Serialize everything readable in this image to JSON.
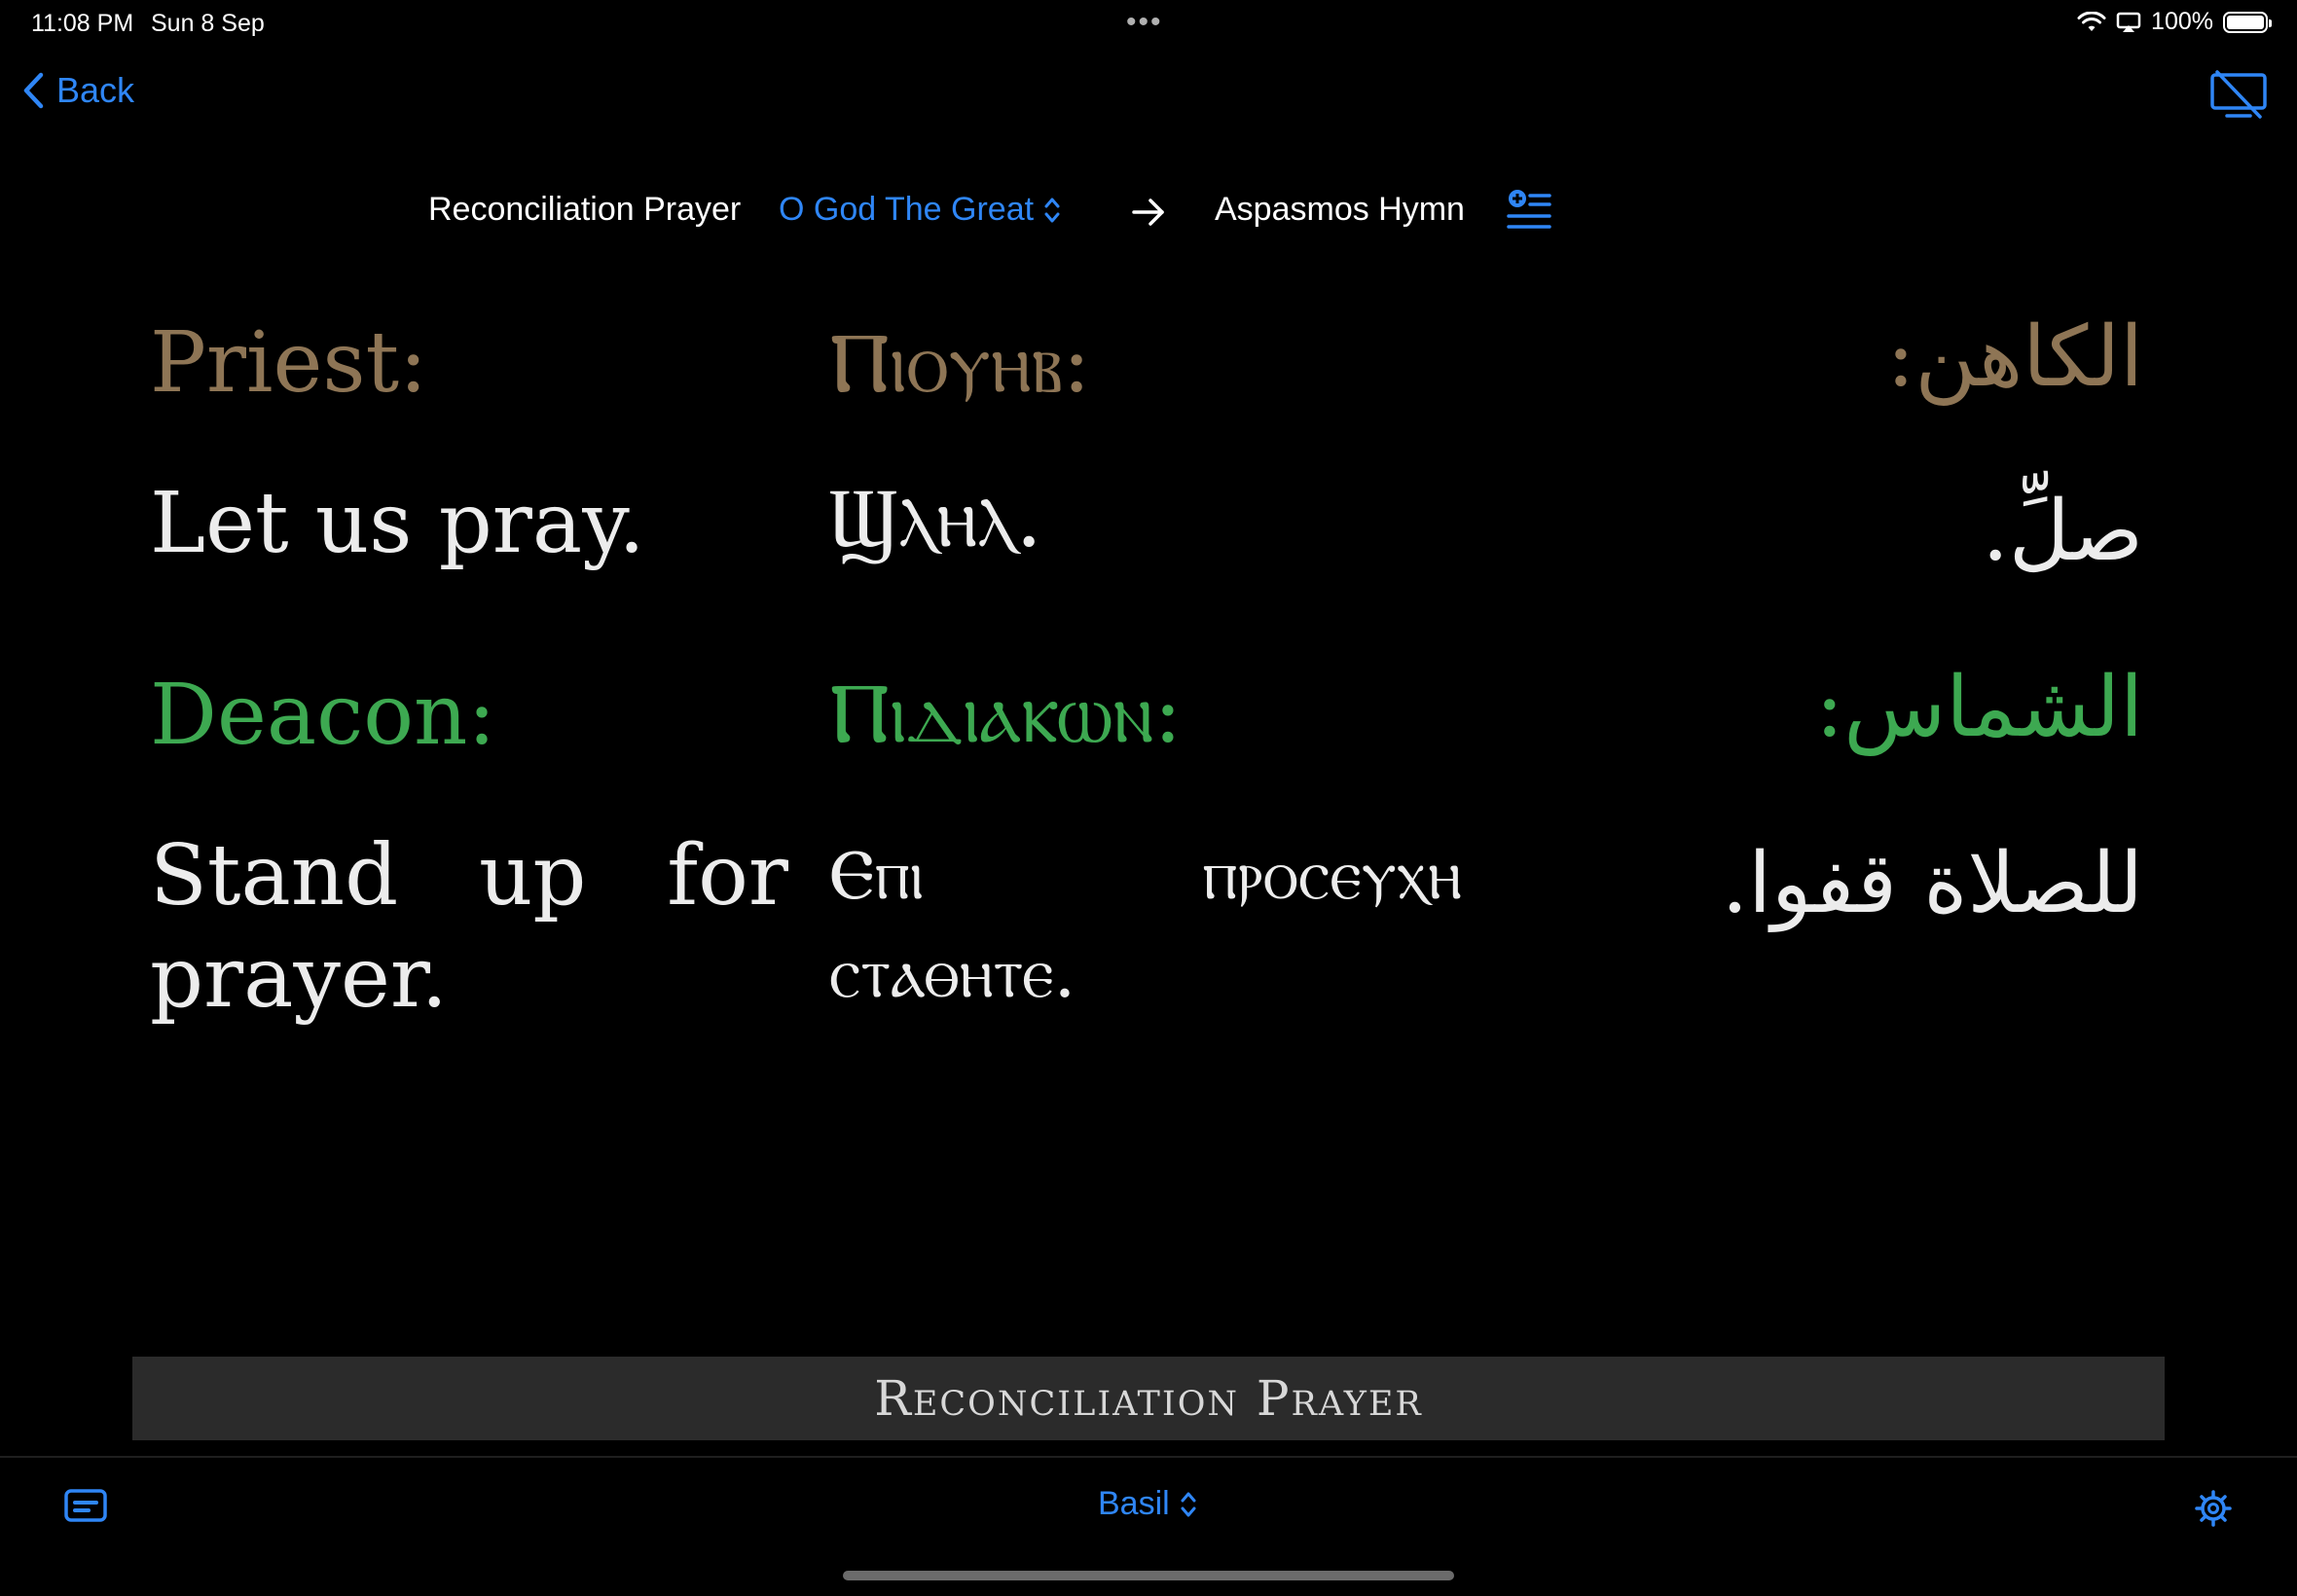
{
  "status_bar": {
    "time": "11:08 PM",
    "date": "Sun 8 Sep",
    "multitask_dots": "•••",
    "battery_percent": "100%",
    "battery_level": 1.0
  },
  "nav": {
    "back_label": "Back",
    "screen_icon": "screen-mirroring-off-icon"
  },
  "navigation": {
    "previous": "Reconciliation Prayer",
    "current": "O God The Great",
    "next": "Aspasmos Hymn",
    "arrow_icon": "arrow-right-icon",
    "list_icon": "list-add-icon"
  },
  "blocks": [
    {
      "role": "priest",
      "color": "#8e7555",
      "english_role": "Priest:",
      "coptic_role": "Ⲡⲓⲟⲩⲏⲃ:",
      "arabic_role": "الكاهن:",
      "english_text": "Let us pray.",
      "coptic_text": "Ϣⲗⲏⲗ.",
      "arabic_text": "صلِّ."
    },
    {
      "role": "deacon",
      "color": "#3da951",
      "english_role": "Deacon:",
      "coptic_role": "Ⲡⲓⲇⲓⲁⲕⲱⲛ:",
      "arabic_role": "الشماس:",
      "english_text": "Stand up for prayer.",
      "coptic_text": "Ⲉⲡⲓ ⲡⲣⲟⲥⲉⲩⲭⲏ ⲥⲧⲁⲑⲏⲧⲉ.",
      "arabic_text": "للصلاة قفوا."
    }
  ],
  "section_title": "Reconciliation Prayer",
  "toolbar": {
    "left_icon": "subtitles-icon",
    "liturgy": "Basil",
    "settings_icon": "gear-icon"
  },
  "colors": {
    "accent": "#2f86f6",
    "background": "#000000",
    "section_bar": "#2b2b2b"
  }
}
